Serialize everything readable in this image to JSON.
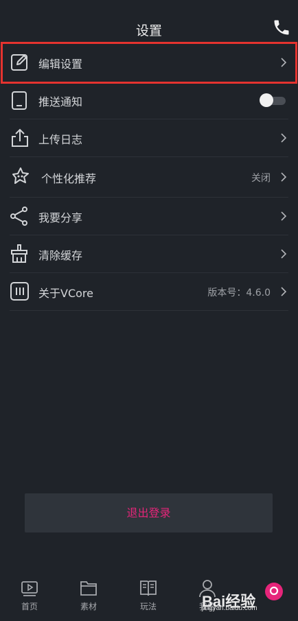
{
  "header": {
    "title": "设置"
  },
  "settings": {
    "items": [
      {
        "label": "编辑设置",
        "icon": "edit-icon"
      },
      {
        "label": "推送通知",
        "icon": "tablet-icon",
        "toggle": false
      },
      {
        "label": "上传日志",
        "icon": "upload-icon"
      },
      {
        "label": "个性化推荐",
        "icon": "personalize-icon",
        "value": "关闭"
      },
      {
        "label": "我要分享",
        "icon": "share-icon"
      },
      {
        "label": "清除缓存",
        "icon": "clear-cache-icon"
      },
      {
        "label": "关于VCore",
        "icon": "about-icon",
        "value": "版本号：4.6.0"
      }
    ]
  },
  "logout": {
    "label": "退出登录"
  },
  "tabs": [
    {
      "label": "首页",
      "icon": "play-screen-icon"
    },
    {
      "label": "素材",
      "icon": "folder-icon"
    },
    {
      "label": "玩法",
      "icon": "book-icon"
    },
    {
      "label": "我的",
      "icon": "person-icon"
    }
  ],
  "watermark": {
    "text": "Bai经验",
    "sub": "jingyan.baidu.com"
  },
  "colors": {
    "background": "#1f2329",
    "accent": "#e6257a",
    "highlight": "#e5332f"
  }
}
